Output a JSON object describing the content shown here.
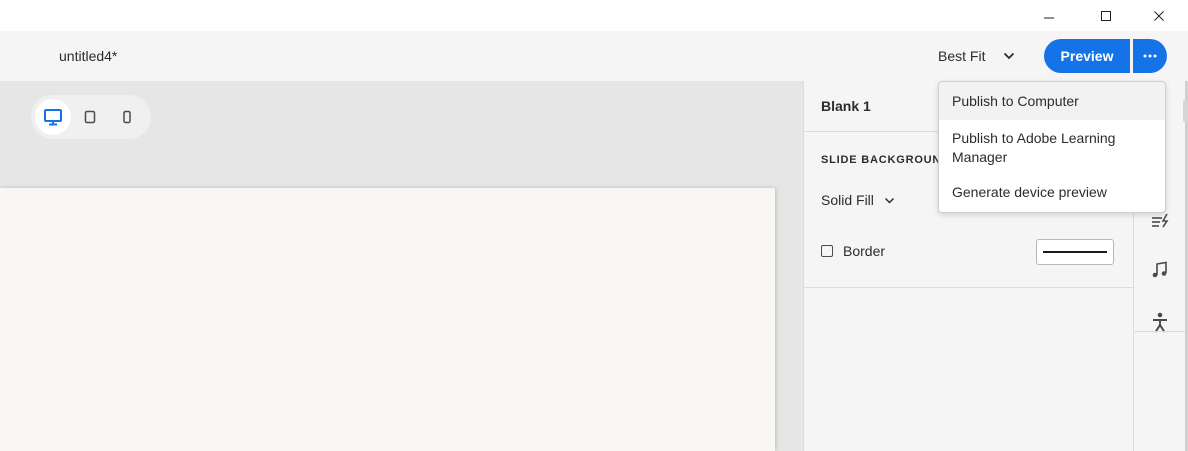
{
  "window": {
    "minimize_icon": "minimize-icon",
    "maximize_icon": "maximize-icon",
    "close_icon": "close-icon"
  },
  "toolbar": {
    "document_title": "untitled4*",
    "zoom_value": "Best Fit",
    "preview_label": "Preview",
    "more_label": "···"
  },
  "device_toggle": {
    "options": [
      "desktop",
      "tablet",
      "mobile"
    ],
    "selected": "desktop"
  },
  "properties_panel": {
    "slide_name": "Blank 1",
    "section_label": "SLIDE BACKGROUN",
    "fill_type": "Solid Fill",
    "border_label": "Border",
    "border_checked": false
  },
  "right_rail": {
    "icons": [
      "actions-icon",
      "audio-icon",
      "accessibility-icon"
    ]
  },
  "publish_menu": {
    "items": [
      {
        "label": "Publish to Computer"
      },
      {
        "label": "Publish to Adobe Learning Manager"
      },
      {
        "label": "Generate device preview"
      }
    ],
    "hovered_index": 0
  },
  "colors": {
    "accent": "#1473e6",
    "canvas": "#e6e6e6",
    "slide": "#f8f7f4",
    "panel": "#f5f5f5"
  }
}
